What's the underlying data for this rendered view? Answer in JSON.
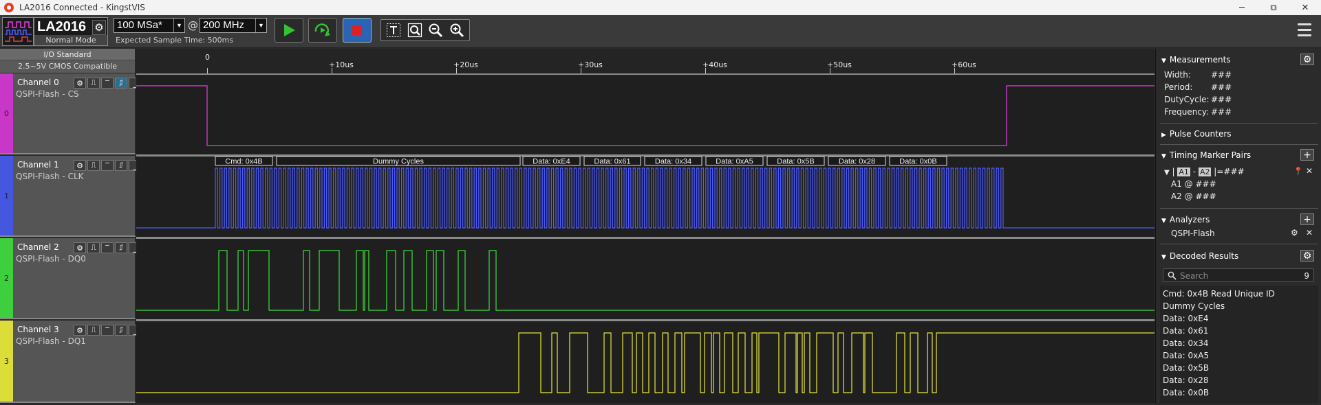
{
  "window": {
    "title": "LA2016 Connected - KingstVIS",
    "minimize": "─",
    "maximize": "⧉",
    "close": "✕"
  },
  "toolbar": {
    "device_name": "LA2016",
    "device_mode": "Normal Mode",
    "sample_rate": "100 MSa*",
    "at": "@",
    "sample_freq": "200 MHz",
    "expected_time": "Expected Sample Time: 500ms"
  },
  "io": {
    "title": "I/O Standard",
    "value": "2.5~5V CMOS Compatible"
  },
  "ruler": {
    "ticks": [
      {
        "label": "0",
        "t": 0
      },
      {
        "label": "+10us",
        "t": 10
      },
      {
        "label": "+20us",
        "t": 20
      },
      {
        "label": "+30us",
        "t": 30
      },
      {
        "label": "+40us",
        "t": 40
      },
      {
        "label": "+50us",
        "t": 50
      },
      {
        "label": "+60us",
        "t": 60
      }
    ]
  },
  "channels": [
    {
      "index": "0",
      "name": "Channel 0",
      "desc": "QSPI-Flash - CS",
      "color": "#e83ee8",
      "strip": "#c837c8"
    },
    {
      "index": "1",
      "name": "Channel 1",
      "desc": "QSPI-Flash - CLK",
      "color": "#4e5cff",
      "strip": "#4556e0"
    },
    {
      "index": "2",
      "name": "Channel 2",
      "desc": "QSPI-Flash - DQ0",
      "color": "#3ee03e",
      "strip": "#3ecf3e"
    },
    {
      "index": "3",
      "name": "Channel 3",
      "desc": "QSPI-Flash - DQ1",
      "color": "#e8e83a",
      "strip": "#dcdc3a"
    }
  ],
  "decode_labels": [
    "Cmd: 0x4B",
    "Dummy Cycles",
    "Data: 0xE4",
    "Data: 0x61",
    "Data: 0x34",
    "Data: 0xA5",
    "Data: 0x5B",
    "Data: 0x28",
    "Data: 0x0B"
  ],
  "panel": {
    "measurements": {
      "title": "Measurements",
      "rows": [
        {
          "k": "Width:",
          "v": "###"
        },
        {
          "k": "Period:",
          "v": "###"
        },
        {
          "k": "DutyCycle:",
          "v": "###"
        },
        {
          "k": "Frequency:",
          "v": "###"
        }
      ]
    },
    "pulse_counters": "Pulse Counters",
    "timing": {
      "title": "Timing Marker Pairs",
      "pair_prefix": "|",
      "a1": "A1",
      "dash": "-",
      "a2": "A2",
      "pair_suffix": "|=###",
      "a1_at": "A1 @ ###",
      "a2_at": "A2 @ ###"
    },
    "analyzers": {
      "title": "Analyzers",
      "item": "QSPI-Flash"
    },
    "decoded": {
      "title": "Decoded Results",
      "search_placeholder": "Search",
      "count": "9",
      "rows": [
        "Cmd: 0x4B Read Unique ID",
        "Dummy Cycles",
        "Data: 0xE4",
        "Data: 0x61",
        "Data: 0x34",
        "Data: 0xA5",
        "Data: 0x5B",
        "Data: 0x28",
        "Data: 0x0B"
      ]
    }
  }
}
